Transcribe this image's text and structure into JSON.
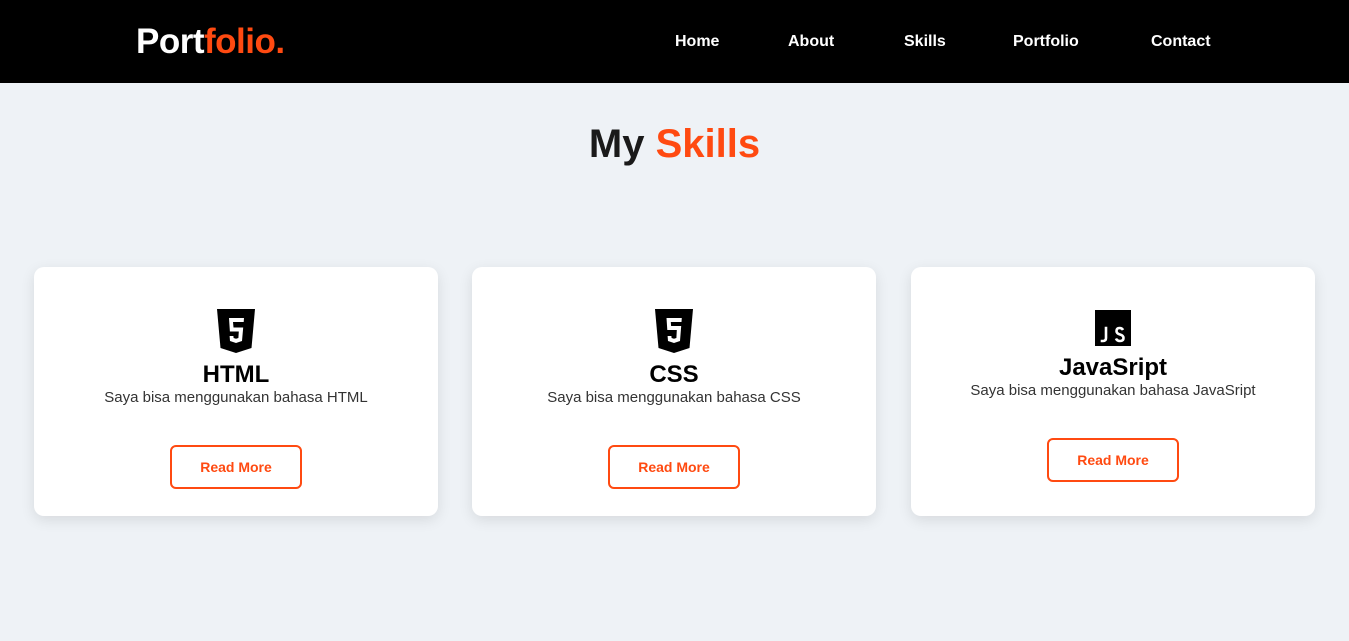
{
  "colors": {
    "accent": "#ff4a11",
    "navbar_bg": "#000000",
    "page_bg": "#eef2f6",
    "card_bg": "#ffffff"
  },
  "navbar": {
    "logo_primary": "Port",
    "logo_accent": "folio.",
    "links": [
      {
        "label": "Home"
      },
      {
        "label": "About"
      },
      {
        "label": "Skills"
      },
      {
        "label": "Portfolio"
      },
      {
        "label": "Contact"
      }
    ]
  },
  "skills_section": {
    "title_primary": "My",
    "title_accent": "Skills",
    "cards": [
      {
        "icon": "html5-icon",
        "title": "HTML",
        "description": "Saya bisa menggunakan bahasa HTML",
        "button_label": "Read More"
      },
      {
        "icon": "css3-icon",
        "title": "CSS",
        "description": "Saya bisa menggunakan bahasa CSS",
        "button_label": "Read More"
      },
      {
        "icon": "javascript-icon",
        "title": "JavaSript",
        "description": "Saya bisa menggunakan bahasa JavaSript",
        "button_label": "Read More"
      }
    ]
  }
}
